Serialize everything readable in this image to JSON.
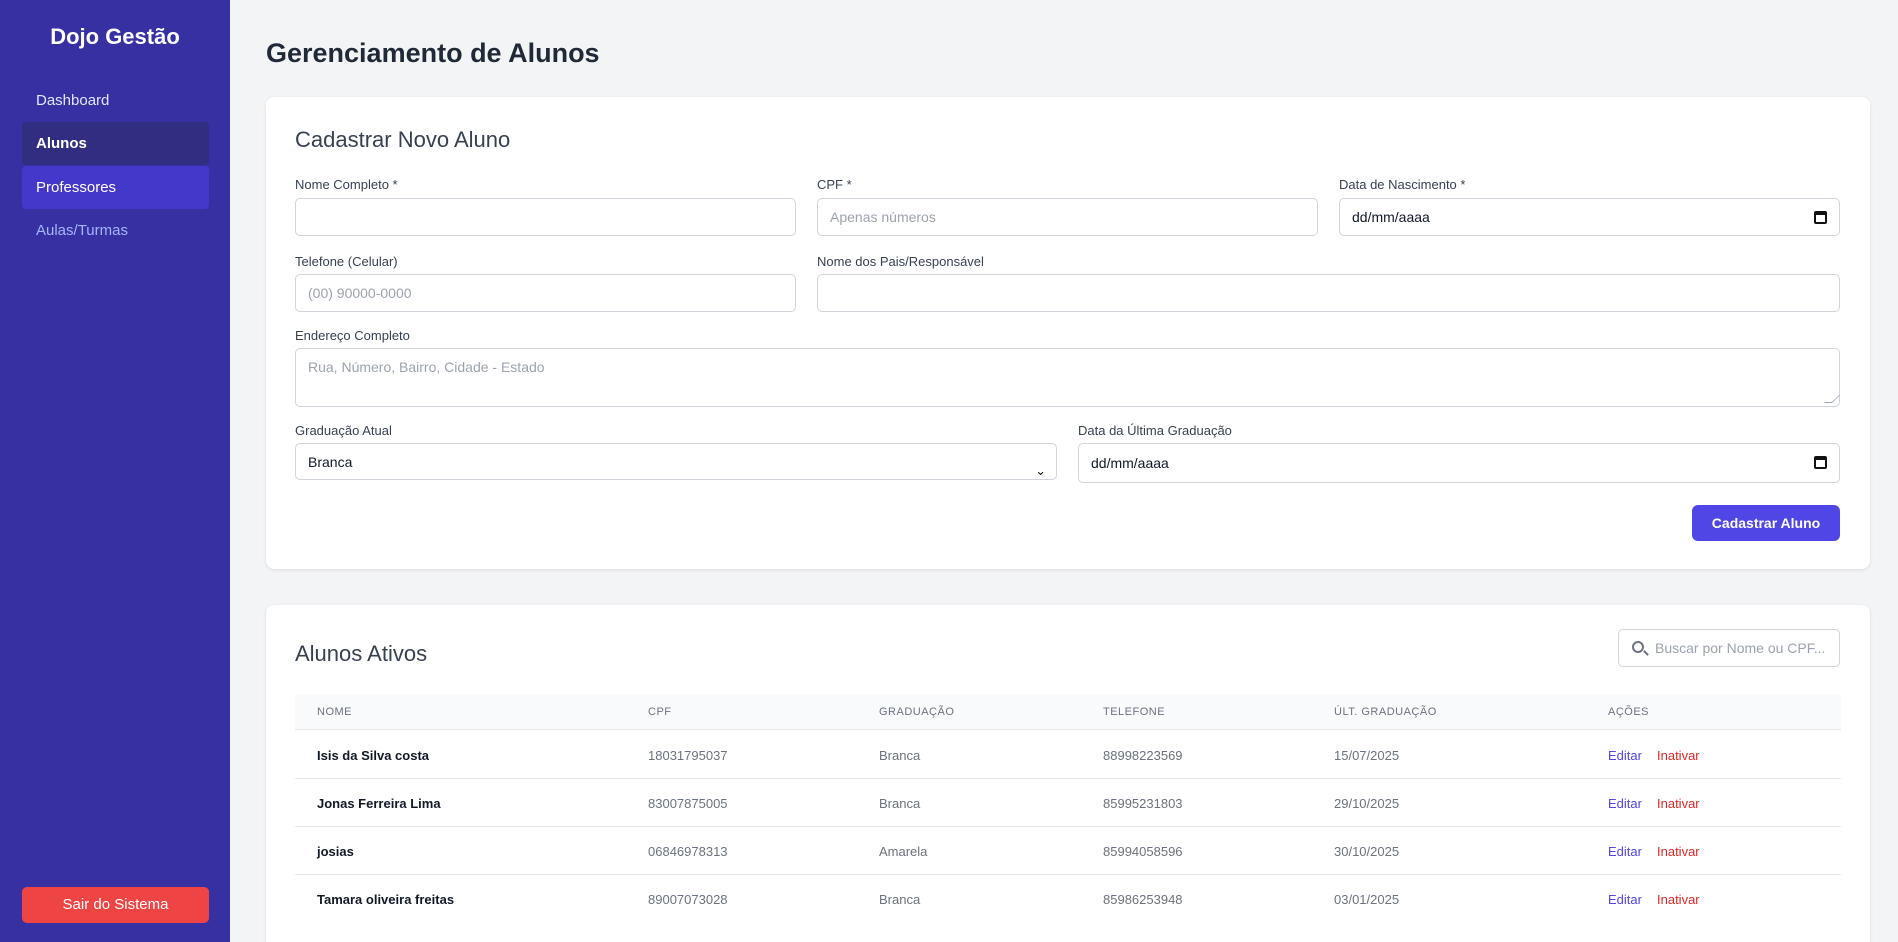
{
  "sidebar": {
    "brand": "Dojo Gestão",
    "items": [
      {
        "label": "Dashboard"
      },
      {
        "label": "Alunos"
      },
      {
        "label": "Professores"
      },
      {
        "label": "Aulas/Turmas"
      }
    ],
    "logout": "Sair do Sistema"
  },
  "page": {
    "title": "Gerenciamento de Alunos"
  },
  "form": {
    "title": "Cadastrar Novo Aluno",
    "name_label": "Nome Completo *",
    "name_value": "",
    "cpf_label": "CPF *",
    "cpf_placeholder": "Apenas números",
    "birth_label": "Data de Nascimento *",
    "birth_value": "dd/mm/aaaa",
    "phone_label": "Telefone (Celular)",
    "phone_placeholder": "(00) 90000-0000",
    "parents_label": "Nome dos Pais/Responsável",
    "address_label": "Endereço Completo",
    "address_placeholder": "Rua, Número, Bairro, Cidade - Estado",
    "belt_label": "Graduação Atual",
    "belt_value": "Branca",
    "last_grad_label": "Data da Última Graduação",
    "last_grad_value": "dd/mm/aaaa",
    "submit": "Cadastrar Aluno"
  },
  "list": {
    "title": "Alunos Ativos",
    "search_placeholder": "Buscar por Nome ou CPF...",
    "columns": [
      "NOME",
      "CPF",
      "GRADUAÇÃO",
      "TELEFONE",
      "ÚLT. GRADUAÇÃO",
      "AÇÕES"
    ],
    "edit_label": "Editar",
    "deactivate_label": "Inativar",
    "rows": [
      {
        "name": "Isis da Silva costa",
        "cpf": "18031795037",
        "belt": "Branca",
        "phone": "88998223569",
        "last": "15/07/2025"
      },
      {
        "name": "Jonas Ferreira Lima",
        "cpf": "83007875005",
        "belt": "Branca",
        "phone": "85995231803",
        "last": "29/10/2025"
      },
      {
        "name": "josias",
        "cpf": "06846978313",
        "belt": "Amarela",
        "phone": "85994058596",
        "last": "30/10/2025"
      },
      {
        "name": "Tamara oliveira freitas",
        "cpf": "89007073028",
        "belt": "Branca",
        "phone": "85986253948",
        "last": "03/01/2025"
      }
    ]
  },
  "colors": {
    "sidebar": "#3730a3",
    "accent": "#4f46e5",
    "danger": "#ef4444"
  }
}
